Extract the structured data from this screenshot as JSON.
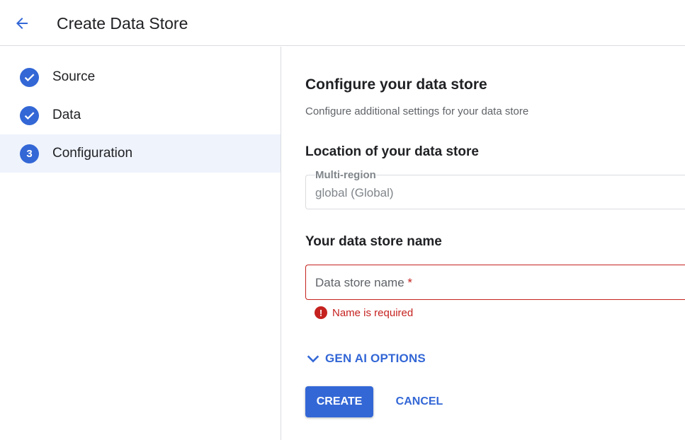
{
  "header": {
    "title": "Create Data Store",
    "back_icon": "arrow-back-icon"
  },
  "steps": [
    {
      "label": "Source",
      "state": "complete",
      "icon": "check-icon"
    },
    {
      "label": "Data",
      "state": "complete",
      "icon": "check-icon"
    },
    {
      "label": "Configuration",
      "state": "active",
      "number": "3"
    }
  ],
  "main": {
    "title": "Configure your data store",
    "description": "Configure additional settings for your data store",
    "location": {
      "heading": "Location of your data store",
      "field_label": "Multi-region",
      "field_value": "global (Global)"
    },
    "name": {
      "heading": "Your data store name",
      "placeholder": "Data store name",
      "required_mark": "*",
      "error": "Name is required"
    },
    "gen_ai_label": "GEN AI OPTIONS",
    "create_label": "CREATE",
    "cancel_label": "CANCEL"
  },
  "colors": {
    "accent": "#3367d6",
    "error": "#c5221f",
    "active_step_bg": "#eef3fc"
  }
}
